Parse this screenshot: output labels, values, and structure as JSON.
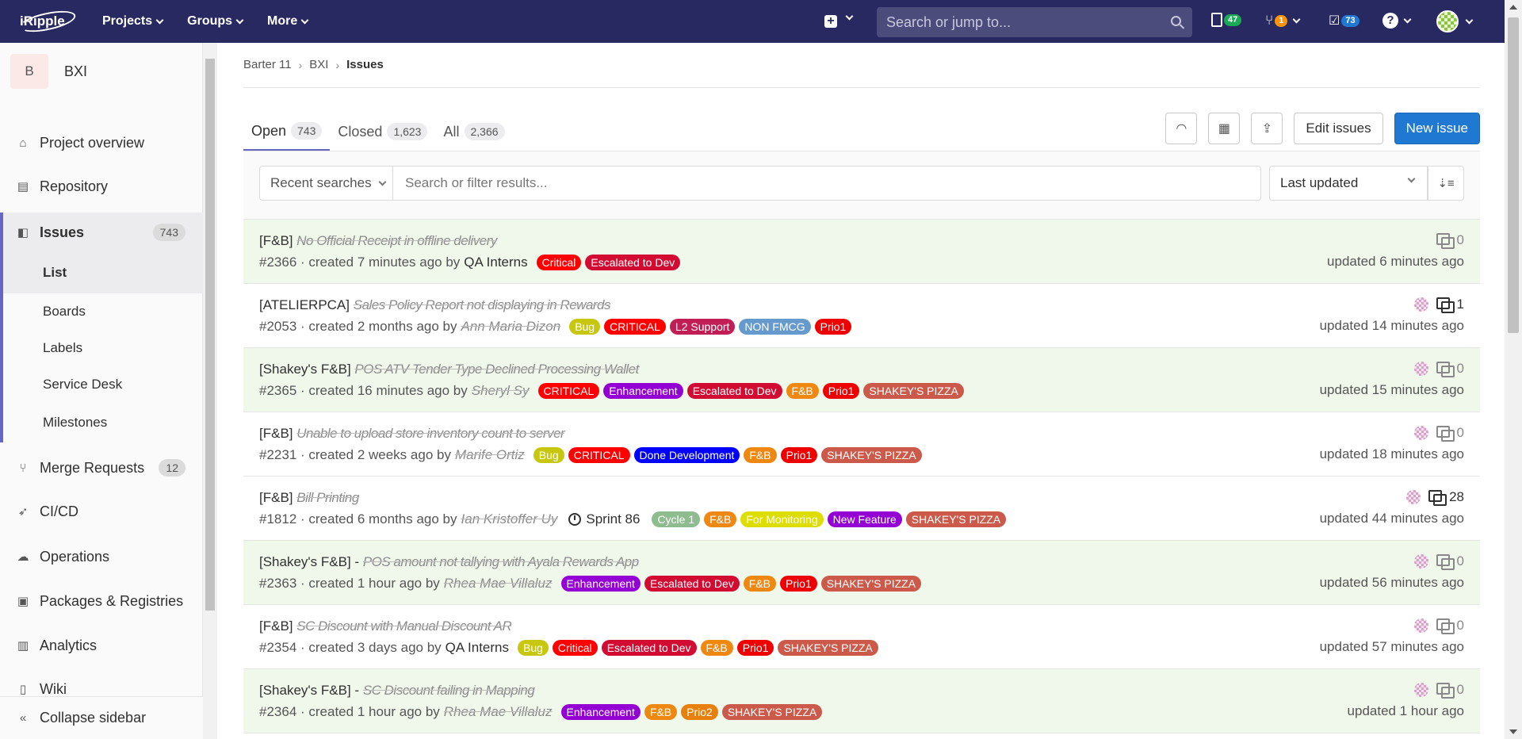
{
  "topnav": {
    "logo": "iRipple",
    "menu": [
      "Projects",
      "Groups",
      "More"
    ],
    "search_placeholder": "Search or jump to...",
    "issues_count": "47",
    "mr_count": "1",
    "todo_count": "73",
    "help": "?",
    "colors": {
      "bg": "#292961",
      "issues_badge": "#1aaa55",
      "mr_badge": "#fc9403",
      "todo_badge": "#1f78d1"
    }
  },
  "sidebar": {
    "project_initial": "B",
    "project_name": "BXI",
    "items": [
      {
        "label": "Project overview",
        "icon": "home-icon"
      },
      {
        "label": "Repository",
        "icon": "doc-icon"
      },
      {
        "label": "Issues",
        "icon": "issues-icon",
        "count": "743"
      },
      {
        "label": "Merge Requests",
        "icon": "merge-request-icon",
        "count": "12"
      },
      {
        "label": "CI/CD",
        "icon": "rocket-icon"
      },
      {
        "label": "Operations",
        "icon": "cloud-icon"
      },
      {
        "label": "Packages & Registries",
        "icon": "package-icon"
      },
      {
        "label": "Analytics",
        "icon": "chart-icon"
      },
      {
        "label": "Wiki",
        "icon": "book-icon"
      }
    ],
    "sub_items": [
      "List",
      "Boards",
      "Labels",
      "Service Desk",
      "Milestones"
    ],
    "collapse_label": "Collapse sidebar"
  },
  "breadcrumb": [
    "Barter 11",
    "BXI",
    "Issues"
  ],
  "tabs": [
    {
      "label": "Open",
      "count": "743"
    },
    {
      "label": "Closed",
      "count": "1,623"
    },
    {
      "label": "All",
      "count": "2,366"
    }
  ],
  "actions": {
    "edit": "Edit issues",
    "new": "New issue"
  },
  "filter": {
    "recent": "Recent searches",
    "placeholder": "Search or filter results...",
    "sort": "Last updated"
  },
  "label_colors": {
    "Critical": "#ff0000",
    "CRITICAL": "#ff0000",
    "Escalated to Dev": "#d10b32",
    "Bug": "#c7c710",
    "L2 Support": "#c21e56",
    "NON FMCG": "#6699cc",
    "Prio1": "#ee0000",
    "Prio2": "#e8800e",
    "Enhancement": "#9400d3",
    "F&B": "#ee8811",
    "SHAKEY'S PIZZA": "#cc5a4a",
    "Done Development": "#0000ff",
    "Cycle 1": "#8fbc8f",
    "For Monitoring": "#dddd00",
    "New Feature": "#9400d3"
  },
  "issues": [
    {
      "prefix": "[F&B]",
      "title_obf": "No Official Receipt in offline delivery",
      "id": "#2366",
      "created": "created 7 minutes ago by",
      "author": "QA Interns",
      "author_obf": false,
      "labels": [
        "Critical",
        "Escalated to Dev"
      ],
      "comments": "0",
      "updated": "updated 6 minutes ago",
      "new": true,
      "avatar": false
    },
    {
      "prefix": "[ATELIERPCA]",
      "title_obf": "Sales Policy Report not displaying in Rewards",
      "id": "#2053",
      "created": "created 2 months ago by",
      "author": "Ann Maria Dizon",
      "author_obf": true,
      "labels": [
        "Bug",
        "CRITICAL",
        "L2 Support",
        "NON FMCG",
        "Prio1"
      ],
      "comments": "1",
      "updated": "updated 14 minutes ago",
      "new": false,
      "avatar": true
    },
    {
      "prefix": "[Shakey's F&B]",
      "title_obf": "POS ATV Tender Type Declined Processing Wallet",
      "id": "#2365",
      "created": "created 16 minutes ago by",
      "author": "Sheryl Sy",
      "author_obf": true,
      "labels": [
        "CRITICAL",
        "Enhancement",
        "Escalated to Dev",
        "F&B",
        "Prio1",
        "SHAKEY'S PIZZA"
      ],
      "comments": "0",
      "updated": "updated 15 minutes ago",
      "new": true,
      "avatar": true
    },
    {
      "prefix": "[F&B]",
      "title_obf": "Unable to upload store inventory count to server",
      "id": "#2231",
      "created": "created 2 weeks ago by",
      "author": "Marife Ortiz",
      "author_obf": true,
      "labels": [
        "Bug",
        "CRITICAL",
        "Done Development",
        "F&B",
        "Prio1",
        "SHAKEY'S PIZZA"
      ],
      "comments": "0",
      "updated": "updated 18 minutes ago",
      "new": false,
      "avatar": true
    },
    {
      "prefix": "[F&B]",
      "title_obf": "Bill Printing",
      "id": "#1812",
      "created": "created 6 months ago by",
      "author": "Ian Kristoffer Uy",
      "author_obf": true,
      "milestone": "Sprint 86",
      "labels": [
        "Cycle 1",
        "F&B",
        "For Monitoring",
        "New Feature",
        "SHAKEY'S PIZZA"
      ],
      "comments": "28",
      "updated": "updated 44 minutes ago",
      "new": false,
      "avatar": true
    },
    {
      "prefix": "[Shakey's F&B] -",
      "title_obf": "POS amount not tallying with Ayala Rewards App",
      "id": "#2363",
      "created": "created 1 hour ago by",
      "author": "Rhea Mae Villaluz",
      "author_obf": true,
      "labels": [
        "Enhancement",
        "Escalated to Dev",
        "F&B",
        "Prio1",
        "SHAKEY'S PIZZA"
      ],
      "comments": "0",
      "updated": "updated 56 minutes ago",
      "new": true,
      "avatar": true
    },
    {
      "prefix": "[F&B]",
      "title_obf": "SC Discount with Manual Discount AR",
      "id": "#2354",
      "created": "created 3 days ago by",
      "author": "QA Interns",
      "author_obf": false,
      "labels": [
        "Bug",
        "Critical",
        "Escalated to Dev",
        "F&B",
        "Prio1",
        "SHAKEY'S PIZZA"
      ],
      "comments": "0",
      "updated": "updated 57 minutes ago",
      "new": false,
      "avatar": true
    },
    {
      "prefix": "[Shakey's F&B] -",
      "title_obf": "SC Discount failing in Mapping",
      "id": "#2364",
      "created": "created 1 hour ago by",
      "author": "Rhea Mae Villaluz",
      "author_obf": true,
      "labels": [
        "Enhancement",
        "F&B",
        "Prio2",
        "SHAKEY'S PIZZA"
      ],
      "comments": "0",
      "updated": "updated 1 hour ago",
      "new": true,
      "avatar": true
    }
  ]
}
